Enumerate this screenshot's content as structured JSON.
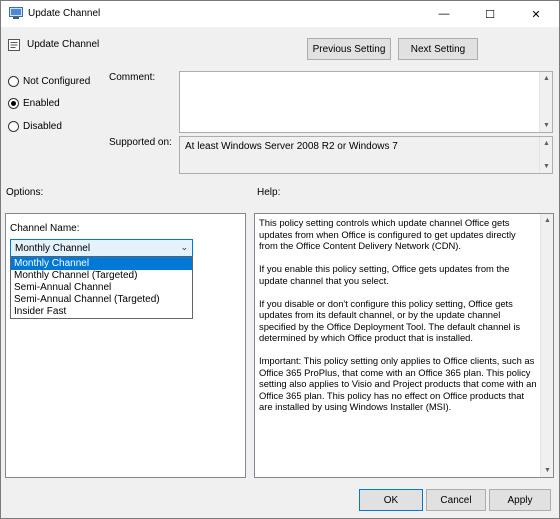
{
  "window": {
    "title": "Update Channel",
    "controls": {
      "minimize": "—",
      "maximize": "☐",
      "close": "✕"
    }
  },
  "header": {
    "title": "Update Channel",
    "previous_setting": "Previous Setting",
    "next_setting": "Next Setting"
  },
  "state": {
    "options": [
      {
        "label": "Not Configured",
        "checked": false
      },
      {
        "label": "Enabled",
        "checked": true
      },
      {
        "label": "Disabled",
        "checked": false
      }
    ]
  },
  "comment": {
    "label": "Comment:",
    "value": ""
  },
  "supported_on": {
    "label": "Supported on:",
    "value": "At least Windows Server 2008 R2 or Windows 7"
  },
  "options_section": {
    "label": "Options:",
    "channel_name_label": "Channel Name:",
    "selected_value": "Monthly Channel",
    "list_items": [
      "Monthly Channel",
      "Monthly Channel (Targeted)",
      "Semi-Annual Channel",
      "Semi-Annual Channel (Targeted)",
      "Insider Fast"
    ],
    "highlighted_index": 0
  },
  "help_section": {
    "label": "Help:",
    "paragraphs": [
      "This policy setting controls which update channel Office gets updates from when Office is configured to get updates directly from the Office Content Delivery Network (CDN).",
      "If you enable this policy setting, Office gets updates from the update channel that you select.",
      "If you disable or don't configure this policy setting, Office gets updates from its default channel, or by the update channel specified by the Office Deployment Tool. The default channel is determined by which Office product that is installed.",
      "Important: This policy setting only applies to Office clients, such as Office 365 ProPlus, that come with an Office 365 plan. This policy setting also applies to Visio and Project products that come with an Office 365 plan. This policy has no effect on Office products that are installed by using Windows Installer (MSI)."
    ]
  },
  "footer": {
    "ok": "OK",
    "cancel": "Cancel",
    "apply": "Apply"
  },
  "colors": {
    "accent": "#0078d7",
    "background": "#f0f0f0"
  }
}
